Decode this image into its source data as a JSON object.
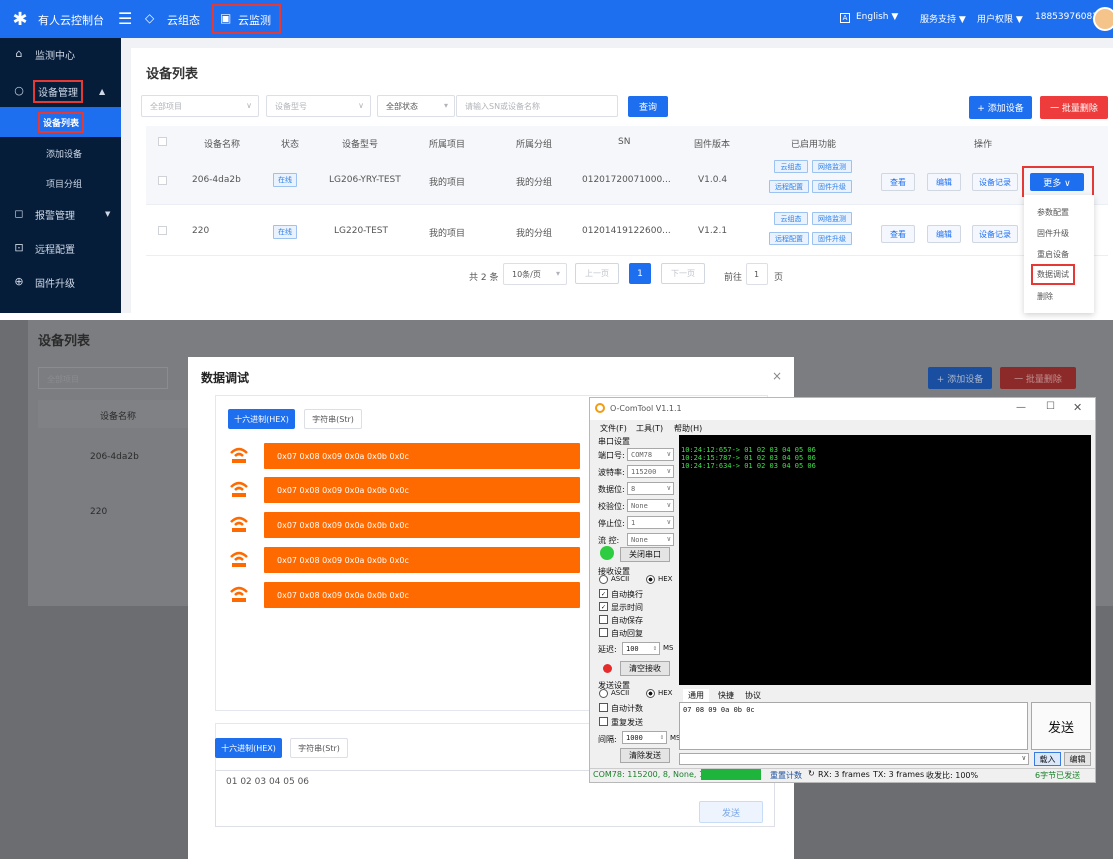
{
  "top": {
    "brand": "有人云控制台",
    "nav": [
      {
        "label": "云组态",
        "icon": "cloud-icon"
      },
      {
        "label": "云监测",
        "icon": "monitor-icon"
      }
    ],
    "right": {
      "lang": "English ▼",
      "support": "服务支持 ▼",
      "perm": "用户权限 ▼",
      "user": "18853976082 ▼"
    },
    "sidebar": {
      "items": [
        {
          "label": "监测中心",
          "icon": "home-icon"
        },
        {
          "label": "设备管理",
          "icon": "device-icon"
        },
        {
          "label": "设备列表"
        },
        {
          "label": "添加设备"
        },
        {
          "label": "项目分组"
        },
        {
          "label": "报警管理",
          "icon": "alarm-icon"
        },
        {
          "label": "远程配置",
          "icon": "remote-config-icon"
        },
        {
          "label": "固件升级",
          "icon": "firmware-icon"
        }
      ]
    },
    "page_title": "设备列表",
    "filters": {
      "project": "全部项目",
      "model": "设备型号",
      "status": "全部状态",
      "search_placeholder": "请输入SN或设备名称",
      "query": "查询"
    },
    "add_btn": "+ 添加设备",
    "del_btn": "一 批量删除",
    "columns": [
      "设备名称",
      "状态",
      "设备型号",
      "所属项目",
      "所属分组",
      "SN",
      "固件版本",
      "已启用功能",
      "操作"
    ],
    "rows": [
      {
        "name": "206-4da2b",
        "status": "在线",
        "model": "LG206-YRY-TEST",
        "project": "我的项目",
        "group": "我的分组",
        "sn": "01201720071000...",
        "fw": "V1.0.4"
      },
      {
        "name": "220",
        "status": "在线",
        "model": "LG220-TEST",
        "project": "我的项目",
        "group": "我的分组",
        "sn": "01201419122600...",
        "fw": "V1.2.1"
      }
    ],
    "features": [
      "云组态",
      "网络监测",
      "远程配置",
      "固件升级"
    ],
    "ops": {
      "view": "查看",
      "edit": "编辑",
      "record": "设备记录",
      "more": "更多 ∨"
    },
    "more_menu": [
      "参数配置",
      "固件升级",
      "重启设备",
      "数据调试",
      "删除"
    ],
    "pager": {
      "total": "共 2 条",
      "size": "10条/页",
      "prev": "上一页",
      "page": "1",
      "next": "下一页",
      "goto": "前往",
      "goto_val": "1",
      "page_unit": "页"
    }
  },
  "bottom": {
    "bg_title": "设备列表",
    "bg_filter": "全部项目",
    "bg_add": "+ 添加设备",
    "bg_del": "一 批量删除",
    "bg_col": "设备名称",
    "bg_rows": [
      "206-4da2b",
      "220"
    ],
    "dialog_title": "数据调试",
    "close": "×",
    "tab_hex": "十六进制(HEX)",
    "tab_str": "字符串(Str)",
    "hex_rows": [
      "0x07 0x08 0x09 0x0a 0x0b 0x0c",
      "0x07 0x08 0x09 0x0a 0x0b 0x0c",
      "0x07 0x08 0x09 0x0a 0x0b 0x0c",
      "0x07 0x08 0x09 0x0a 0x0b 0x0c",
      "0x07 0x08 0x09 0x0a 0x0b 0x0c"
    ],
    "send_text": "01 02 03 04 05 06",
    "send_btn": "发送"
  },
  "com": {
    "title": "O-ComTool V1.1.1",
    "menu": [
      "文件(F)",
      "工具(T)",
      "帮助(H)"
    ],
    "serial_group": "串口设置",
    "fields": [
      {
        "label": "端口号:",
        "value": "COM78"
      },
      {
        "label": "波特率:",
        "value": "115200"
      },
      {
        "label": "数据位:",
        "value": "8"
      },
      {
        "label": "校验位:",
        "value": "None"
      },
      {
        "label": "停止位:",
        "value": "1"
      },
      {
        "label": "流  控:",
        "value": "None"
      }
    ],
    "close_port": "关闭串口",
    "recv_group": "接收设置",
    "ascii": "ASCII",
    "hex": "HEX",
    "recv_checks": [
      {
        "label": "自动换行",
        "checked": true
      },
      {
        "label": "显示时间",
        "checked": true
      },
      {
        "label": "自动保存",
        "checked": false
      },
      {
        "label": "自动回复",
        "checked": false
      }
    ],
    "delay_label": "延迟:",
    "delay_val": "100",
    "ms": "MS",
    "clear_recv": "清空接收",
    "send_group": "发送设置",
    "send_checks": [
      {
        "label": "自动计数",
        "checked": false
      },
      {
        "label": "重复发送",
        "checked": false
      }
    ],
    "interval_label": "间隔:",
    "interval_val": "1000",
    "clear_send": "清除发送",
    "log": [
      "10:24:12:657-> 01 02 03 04 05 06",
      "10:24:15:787-> 01 02 03 04 05 06",
      "10:24:17:634-> 01 02 03 04 05 06"
    ],
    "send_tabs": [
      "通用",
      "快捷",
      "协议"
    ],
    "send_area": "07 08 09 0a 0b 0c",
    "send_btn": "发送",
    "load": "载入",
    "edit": "编辑",
    "status": {
      "port": "COM78: 115200, 8, None, 1",
      "reset": "重置计数",
      "rx": "RX: 3 frames",
      "tx": "TX: 3 frames",
      "ratio": "收发比: 100%",
      "bytes": "6字节已发送"
    }
  }
}
